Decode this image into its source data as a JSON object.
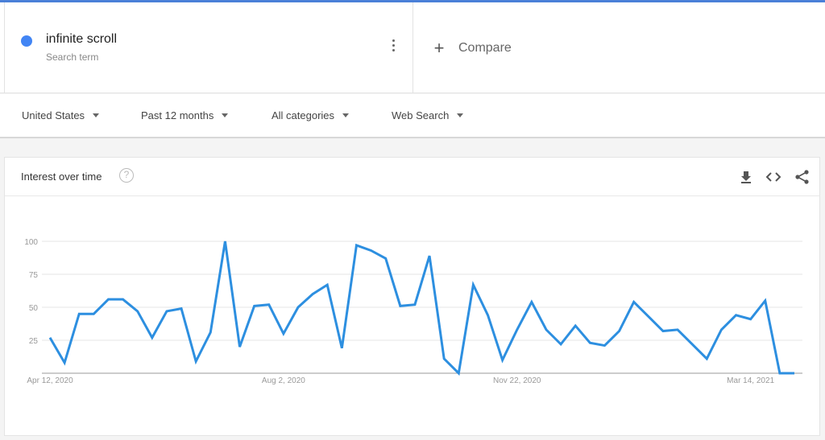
{
  "header": {
    "term": {
      "name": "infinite scroll",
      "sub": "Search term",
      "color": "#4285f4"
    },
    "compare_label": "Compare"
  },
  "filters": [
    {
      "label": "United States"
    },
    {
      "label": "Past 12 months"
    },
    {
      "label": "All categories"
    },
    {
      "label": "Web Search"
    }
  ],
  "card": {
    "title": "Interest over time",
    "help_glyph": "?",
    "tools": [
      "download-icon",
      "embed-icon",
      "share-icon"
    ]
  },
  "chart_data": {
    "type": "line",
    "title": "Interest over time",
    "xlabel": "",
    "ylabel": "",
    "ylim": [
      0,
      100
    ],
    "yticks": [
      25,
      50,
      75,
      100
    ],
    "ytick_labels": [
      "25",
      "50",
      "75",
      "100"
    ],
    "xtick_labels": [
      {
        "label": "Apr 12, 2020",
        "index": 0
      },
      {
        "label": "Aug 2, 2020",
        "index": 16
      },
      {
        "label": "Nov 22, 2020",
        "index": 32
      },
      {
        "label": "Mar 14, 2021",
        "index": 48
      }
    ],
    "grid": true,
    "legend": "none",
    "series": [
      {
        "name": "infinite scroll",
        "color": "#2d8fe0",
        "values": [
          27,
          8,
          45,
          45,
          56,
          56,
          47,
          27,
          47,
          49,
          9,
          31,
          100,
          20,
          51,
          52,
          30,
          50,
          60,
          67,
          19,
          97,
          93,
          87,
          51,
          52,
          89,
          11,
          0,
          67,
          44,
          10,
          33,
          54,
          33,
          22,
          36,
          23,
          21,
          32,
          54,
          43,
          32,
          33,
          22,
          11,
          33,
          44,
          41,
          55,
          0,
          0
        ]
      }
    ]
  }
}
